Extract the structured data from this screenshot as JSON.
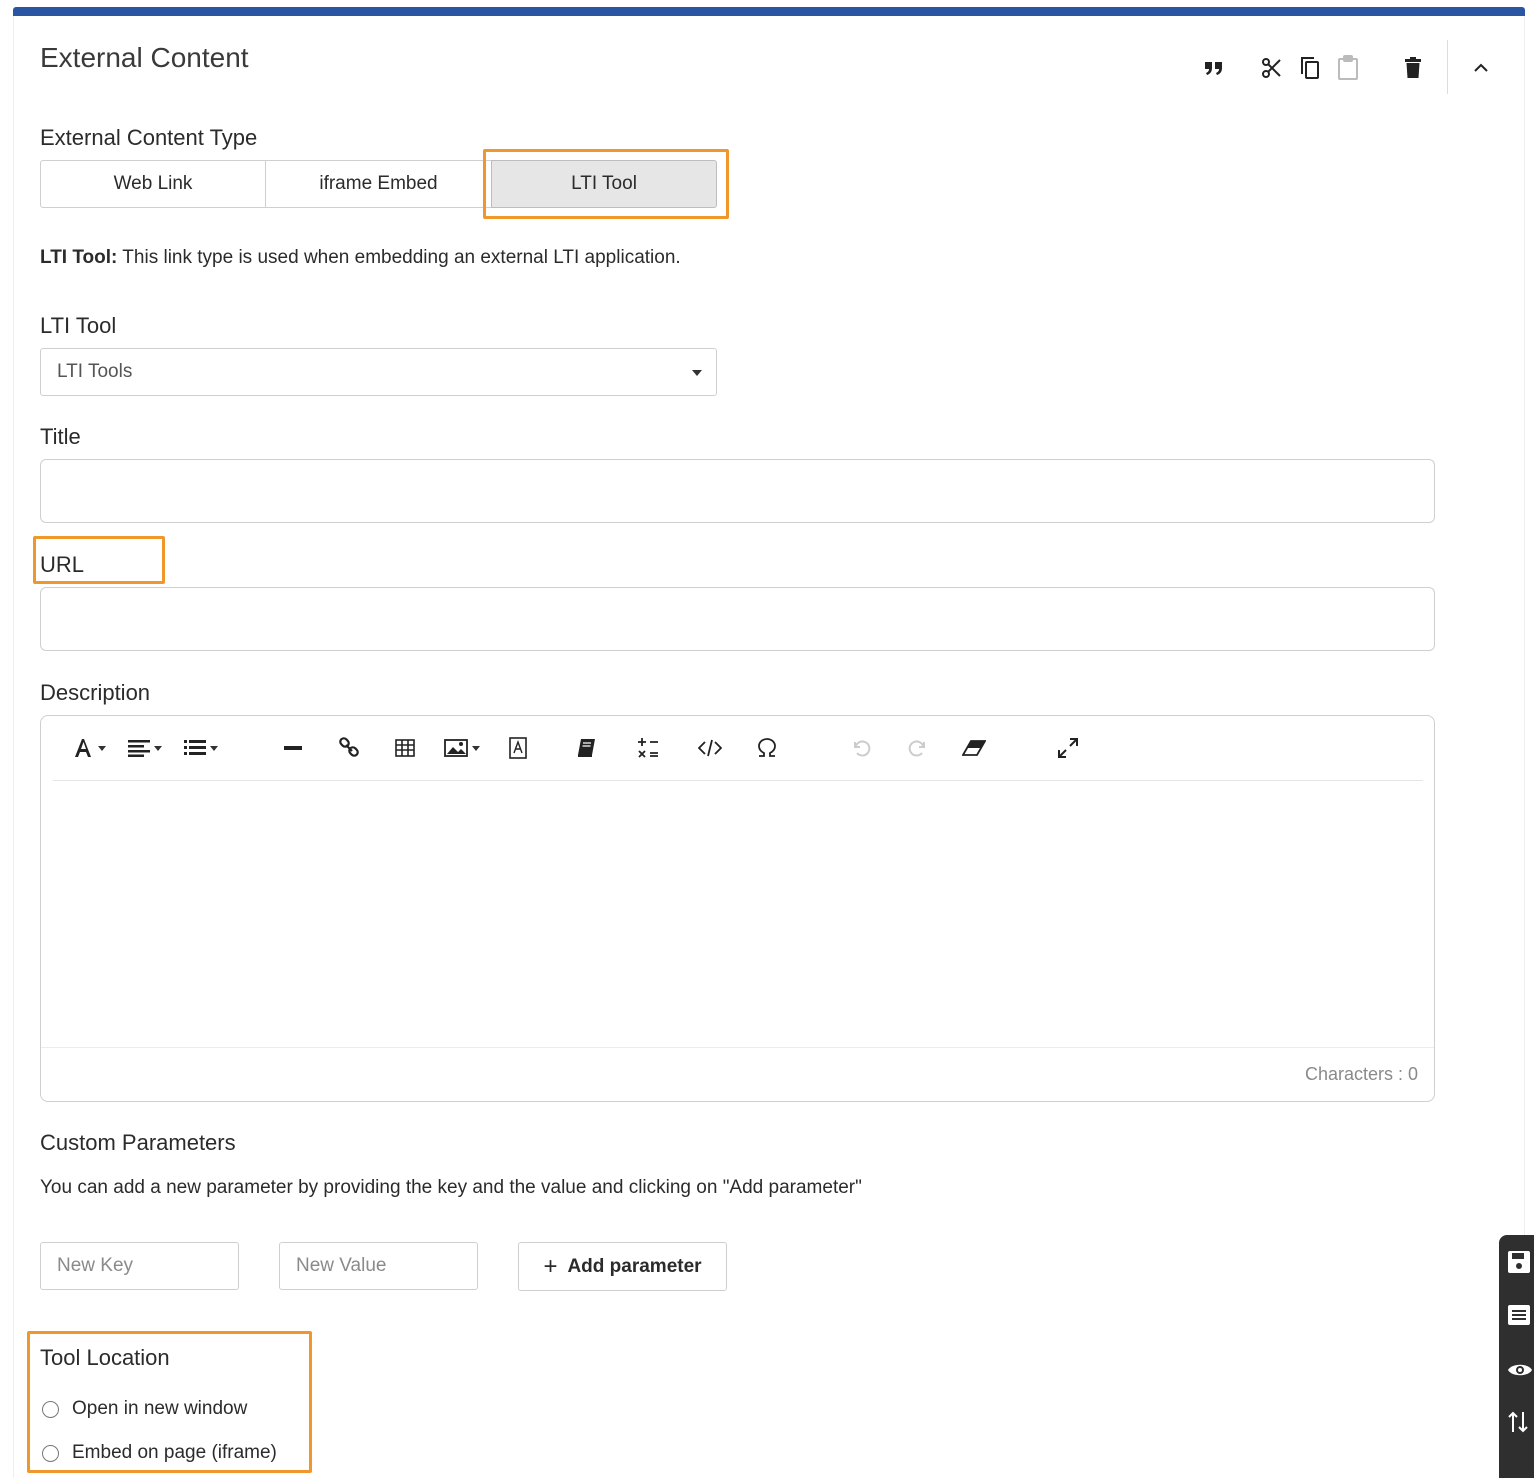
{
  "header": {
    "title": "External Content",
    "icons": [
      "quote-icon",
      "cut-icon",
      "copy-icon",
      "paste-icon",
      "trash-icon",
      "collapse-icon"
    ]
  },
  "content_type": {
    "label": "External Content Type",
    "options": [
      "Web Link",
      "iframe Embed",
      "LTI Tool"
    ],
    "selected": "LTI Tool"
  },
  "description_line": {
    "bold": "LTI Tool:",
    "text": " This link type is used when embedding an external LTI application."
  },
  "lti_tool": {
    "label": "LTI Tool",
    "selected_value": "LTI Tools"
  },
  "title_field": {
    "label": "Title",
    "value": ""
  },
  "url_field": {
    "label": "URL",
    "value": ""
  },
  "description": {
    "label": "Description",
    "toolbar_icons": [
      "font-icon",
      "align-icon",
      "list-icon",
      "horizontal-rule-icon",
      "link-icon",
      "table-icon",
      "image-icon",
      "text-box-icon",
      "book-icon",
      "math-icon",
      "code-icon",
      "omega-icon",
      "undo-icon",
      "redo-icon",
      "eraser-icon",
      "fullscreen-icon"
    ],
    "char_count": "Characters : 0"
  },
  "custom_parameters": {
    "label": "Custom Parameters",
    "help": "You can add a new parameter by providing the key and the value and clicking on \"Add parameter\"",
    "key_placeholder": "New Key",
    "value_placeholder": "New Value",
    "add_label": "Add parameter"
  },
  "tool_location": {
    "label": "Tool Location",
    "options": [
      "Open in new window",
      "Embed on page (iframe)"
    ]
  },
  "side_dock": {
    "icons": [
      "save-icon",
      "list-icon",
      "eye-icon",
      "sort-icon"
    ]
  },
  "colors": {
    "accent_bar": "#2a55a3",
    "highlight": "#f0972c",
    "active_segment": "#e6e6e6"
  }
}
